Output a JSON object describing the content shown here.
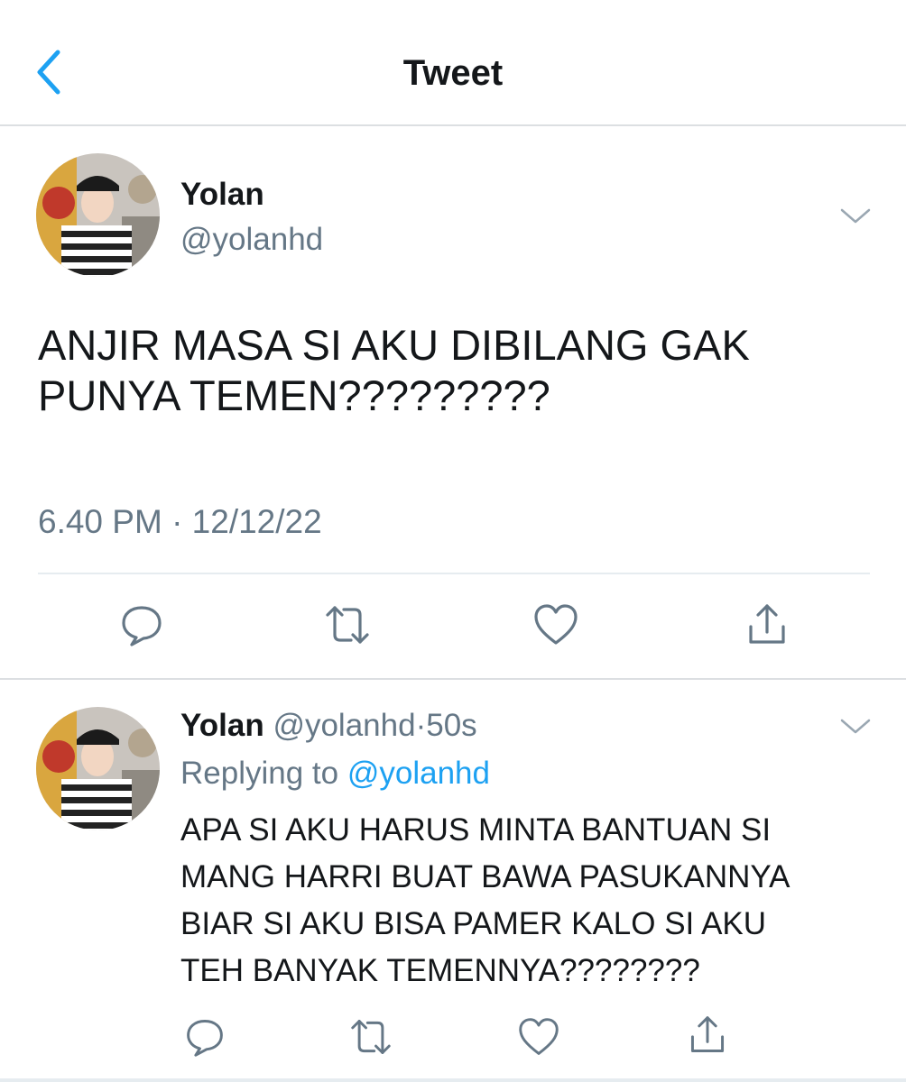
{
  "header": {
    "title": "Tweet"
  },
  "tweet": {
    "author_name": "Yolan",
    "author_handle": "@yolanhd",
    "text_lines": [
      "ANJIR MASA SI AKU DIBILANG GAK",
      "PUNYA TEMEN?????????"
    ],
    "timestamp": "6.40 PM · 12/12/22"
  },
  "reply": {
    "author_name": "Yolan",
    "author_handle": "@yolanhd",
    "separator": "·",
    "age": "50s",
    "replying_to_label": "Replying to",
    "replying_to_handle": "@yolanhd",
    "text_lines": [
      "APA SI AKU HARUS MINTA BANTUAN SI",
      "MANG HARRI BUAT BAWA PASUKANNYA",
      "BIAR SI AKU BISA PAMER KALO SI AKU",
      "TEH BANYAK TEMENNYA????????"
    ]
  },
  "icons": {
    "back": "chevron-left-icon",
    "menu": "chevron-down-icon",
    "reply": "comment-icon",
    "retweet": "retweet-icon",
    "like": "heart-icon",
    "share": "share-icon"
  },
  "colors": {
    "accent": "#1da1f2",
    "muted": "#657786",
    "text": "#14171a"
  }
}
